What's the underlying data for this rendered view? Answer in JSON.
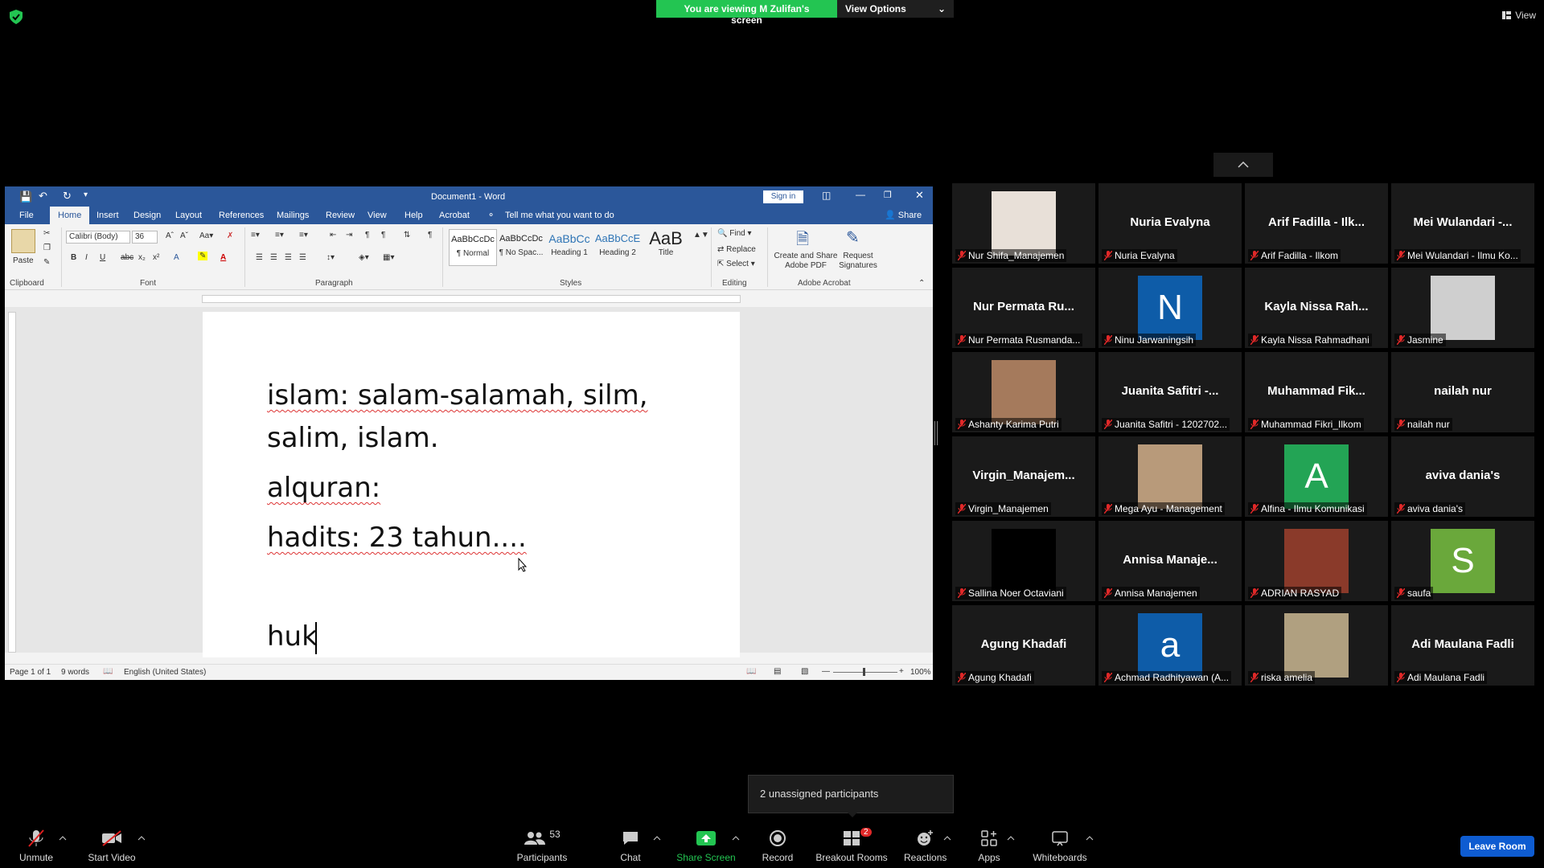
{
  "top_bar": {
    "viewing_text": "You are viewing M Zulifan's screen",
    "view_options": "View Options",
    "view": "View"
  },
  "word": {
    "title": "Document1  -  Word",
    "sign_in": "Sign in",
    "share": "Share",
    "tell_me": "Tell me what you want to do",
    "tabs": [
      "File",
      "Home",
      "Insert",
      "Design",
      "Layout",
      "References",
      "Mailings",
      "Review",
      "View",
      "Help",
      "Acrobat"
    ],
    "font_name": "Calibri (Body)",
    "font_size": "36",
    "paste": "Paste",
    "groups": [
      "Clipboard",
      "Font",
      "Paragraph",
      "Styles",
      "Editing",
      "Adobe Acrobat"
    ],
    "styles": [
      {
        "preview": "AaBbCcDc",
        "name": "¶ Normal"
      },
      {
        "preview": "AaBbCcDc",
        "name": "¶ No Spac..."
      },
      {
        "preview": "AaBbCc",
        "name": "Heading 1"
      },
      {
        "preview": "AaBbCcE",
        "name": "Heading 2"
      },
      {
        "preview": "AaB",
        "name": "Title"
      }
    ],
    "editing": [
      "Find",
      "Replace",
      "Select"
    ],
    "acrobat": {
      "create_share": "Create and Share Adobe PDF",
      "request": "Request Signatures"
    },
    "document_lines": [
      "islam: salam-salamah, silm,",
      "salim, islam.",
      "alquran:",
      "hadits: 23 tahun....",
      "huk"
    ],
    "status": {
      "page": "Page 1 of 1",
      "words": "9 words",
      "language": "English (United States)",
      "zoom": "100%"
    }
  },
  "participants": [
    {
      "tile_name": "",
      "label": "Nur Shifa_Manajemen",
      "avatar": "photo-girl",
      "avatar_color": "#e8e0d8"
    },
    {
      "tile_name": "Nuria Evalyna",
      "label": "Nuria Evalyna"
    },
    {
      "tile_name": "Arif Fadilla - Ilk...",
      "label": "Arif Fadilla - Ilkom"
    },
    {
      "tile_name": "Mei  Wulandari -...",
      "label": "Mei Wulandari - Ilmu Ko..."
    },
    {
      "tile_name": "Nur Permata Ru...",
      "label": "Nur Permata Rusmanda..."
    },
    {
      "tile_name": "",
      "label": "Ninu Jarwaningsih",
      "avatar_letter": "N",
      "avatar_color": "#0e5ca8"
    },
    {
      "tile_name": "Kayla Nissa Rah...",
      "label": "Kayla Nissa Rahmadhani"
    },
    {
      "tile_name": "",
      "label": "Jasmine",
      "avatar": "cartoon",
      "avatar_color": "#cfcfcf"
    },
    {
      "tile_name": "",
      "label": "Ashanty Karima Putri",
      "avatar": "photo-girl-2",
      "avatar_color": "#a57a5c"
    },
    {
      "tile_name": "Juanita Safitri -...",
      "label": "Juanita Safitri - 1202702..."
    },
    {
      "tile_name": "Muhammad  Fik...",
      "label": "Muhammad Fikri_Ilkom"
    },
    {
      "tile_name": "nailah nur",
      "label": "nailah nur"
    },
    {
      "tile_name": "Virgin_Manajem...",
      "label": "Virgin_Manajemen"
    },
    {
      "tile_name": "",
      "label": "Mega Ayu - Management",
      "avatar": "photo-girl-3",
      "avatar_color": "#b89a7a"
    },
    {
      "tile_name": "",
      "label": "Alfina - Ilmu Komunikasi",
      "avatar_letter": "A",
      "avatar_color": "#23a455"
    },
    {
      "tile_name": "aviva dania's",
      "label": "aviva dania's"
    },
    {
      "tile_name": "",
      "label": "Sallina Noer Octaviani",
      "avatar": "black",
      "avatar_color": "#000000"
    },
    {
      "tile_name": "Annisa  Manaje...",
      "label": "Annisa Manajemen"
    },
    {
      "tile_name": "",
      "label": "ADRIAN RASYAD",
      "avatar": "photo-man",
      "avatar_color": "#8a3a2a"
    },
    {
      "tile_name": "",
      "label": "saufa",
      "avatar_letter": "S",
      "avatar_color": "#6aa83b"
    },
    {
      "tile_name": "Agung Khadafi",
      "label": "Agung Khadafi"
    },
    {
      "tile_name": "",
      "label": "Achmad Radhityawan (A...",
      "avatar_letter": "a",
      "avatar_color": "#0e5ca8"
    },
    {
      "tile_name": "",
      "label": "riska amelia",
      "avatar": "photo-hall",
      "avatar_color": "#b0a080"
    },
    {
      "tile_name": "Adi Maulana Fadli",
      "label": "Adi Maulana Fadli"
    }
  ],
  "unassigned": "2 unassigned participants",
  "toolbar": {
    "unmute": "Unmute",
    "start_video": "Start Video",
    "participants": "Participants",
    "participant_count": "53",
    "chat": "Chat",
    "share_screen": "Share Screen",
    "record": "Record",
    "breakout_rooms": "Breakout Rooms",
    "breakout_badge": "2",
    "reactions": "Reactions",
    "apps": "Apps",
    "whiteboards": "Whiteboards",
    "leave_room": "Leave Room"
  },
  "colors": {
    "share_green": "#23c552",
    "word_blue": "#2b579a",
    "leave_blue": "#0e5cd1"
  }
}
